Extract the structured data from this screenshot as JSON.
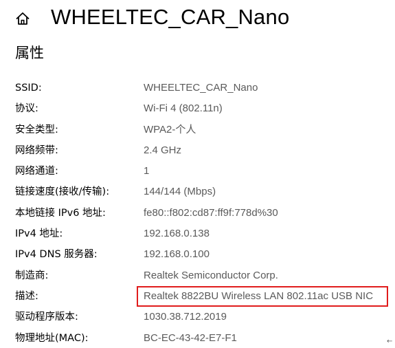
{
  "header": {
    "title": "WHEELTEC_CAR_Nano",
    "home_icon": "home-icon"
  },
  "section": {
    "title": "属性"
  },
  "properties": [
    {
      "label": "SSID:",
      "value": "WHEELTEC_CAR_Nano"
    },
    {
      "label": "协议:",
      "value": "Wi-Fi 4 (802.11n)"
    },
    {
      "label": "安全类型:",
      "value": "WPA2-个人"
    },
    {
      "label": "网络频带:",
      "value": "2.4 GHz"
    },
    {
      "label": "网络通道:",
      "value": "1"
    },
    {
      "label": "链接速度(接收/传输):",
      "value": "144/144 (Mbps)"
    },
    {
      "label": "本地链接 IPv6 地址:",
      "value": "fe80::f802:cd87:ff9f:778d%30"
    },
    {
      "label": "IPv4 地址:",
      "value": "192.168.0.138"
    },
    {
      "label": "IPv4 DNS 服务器:",
      "value": "192.168.0.100"
    },
    {
      "label": "制造商:",
      "value": "Realtek Semiconductor Corp."
    },
    {
      "label": "描述:",
      "value": "Realtek 8822BU Wireless LAN 802.11ac USB NIC"
    },
    {
      "label": "驱动程序版本:",
      "value": "1030.38.712.2019"
    },
    {
      "label": "物理地址(MAC):",
      "value": "BC-EC-43-42-E7-F1"
    }
  ],
  "colors": {
    "highlight": "#e01b1b",
    "value_text": "#5a5a5a"
  }
}
